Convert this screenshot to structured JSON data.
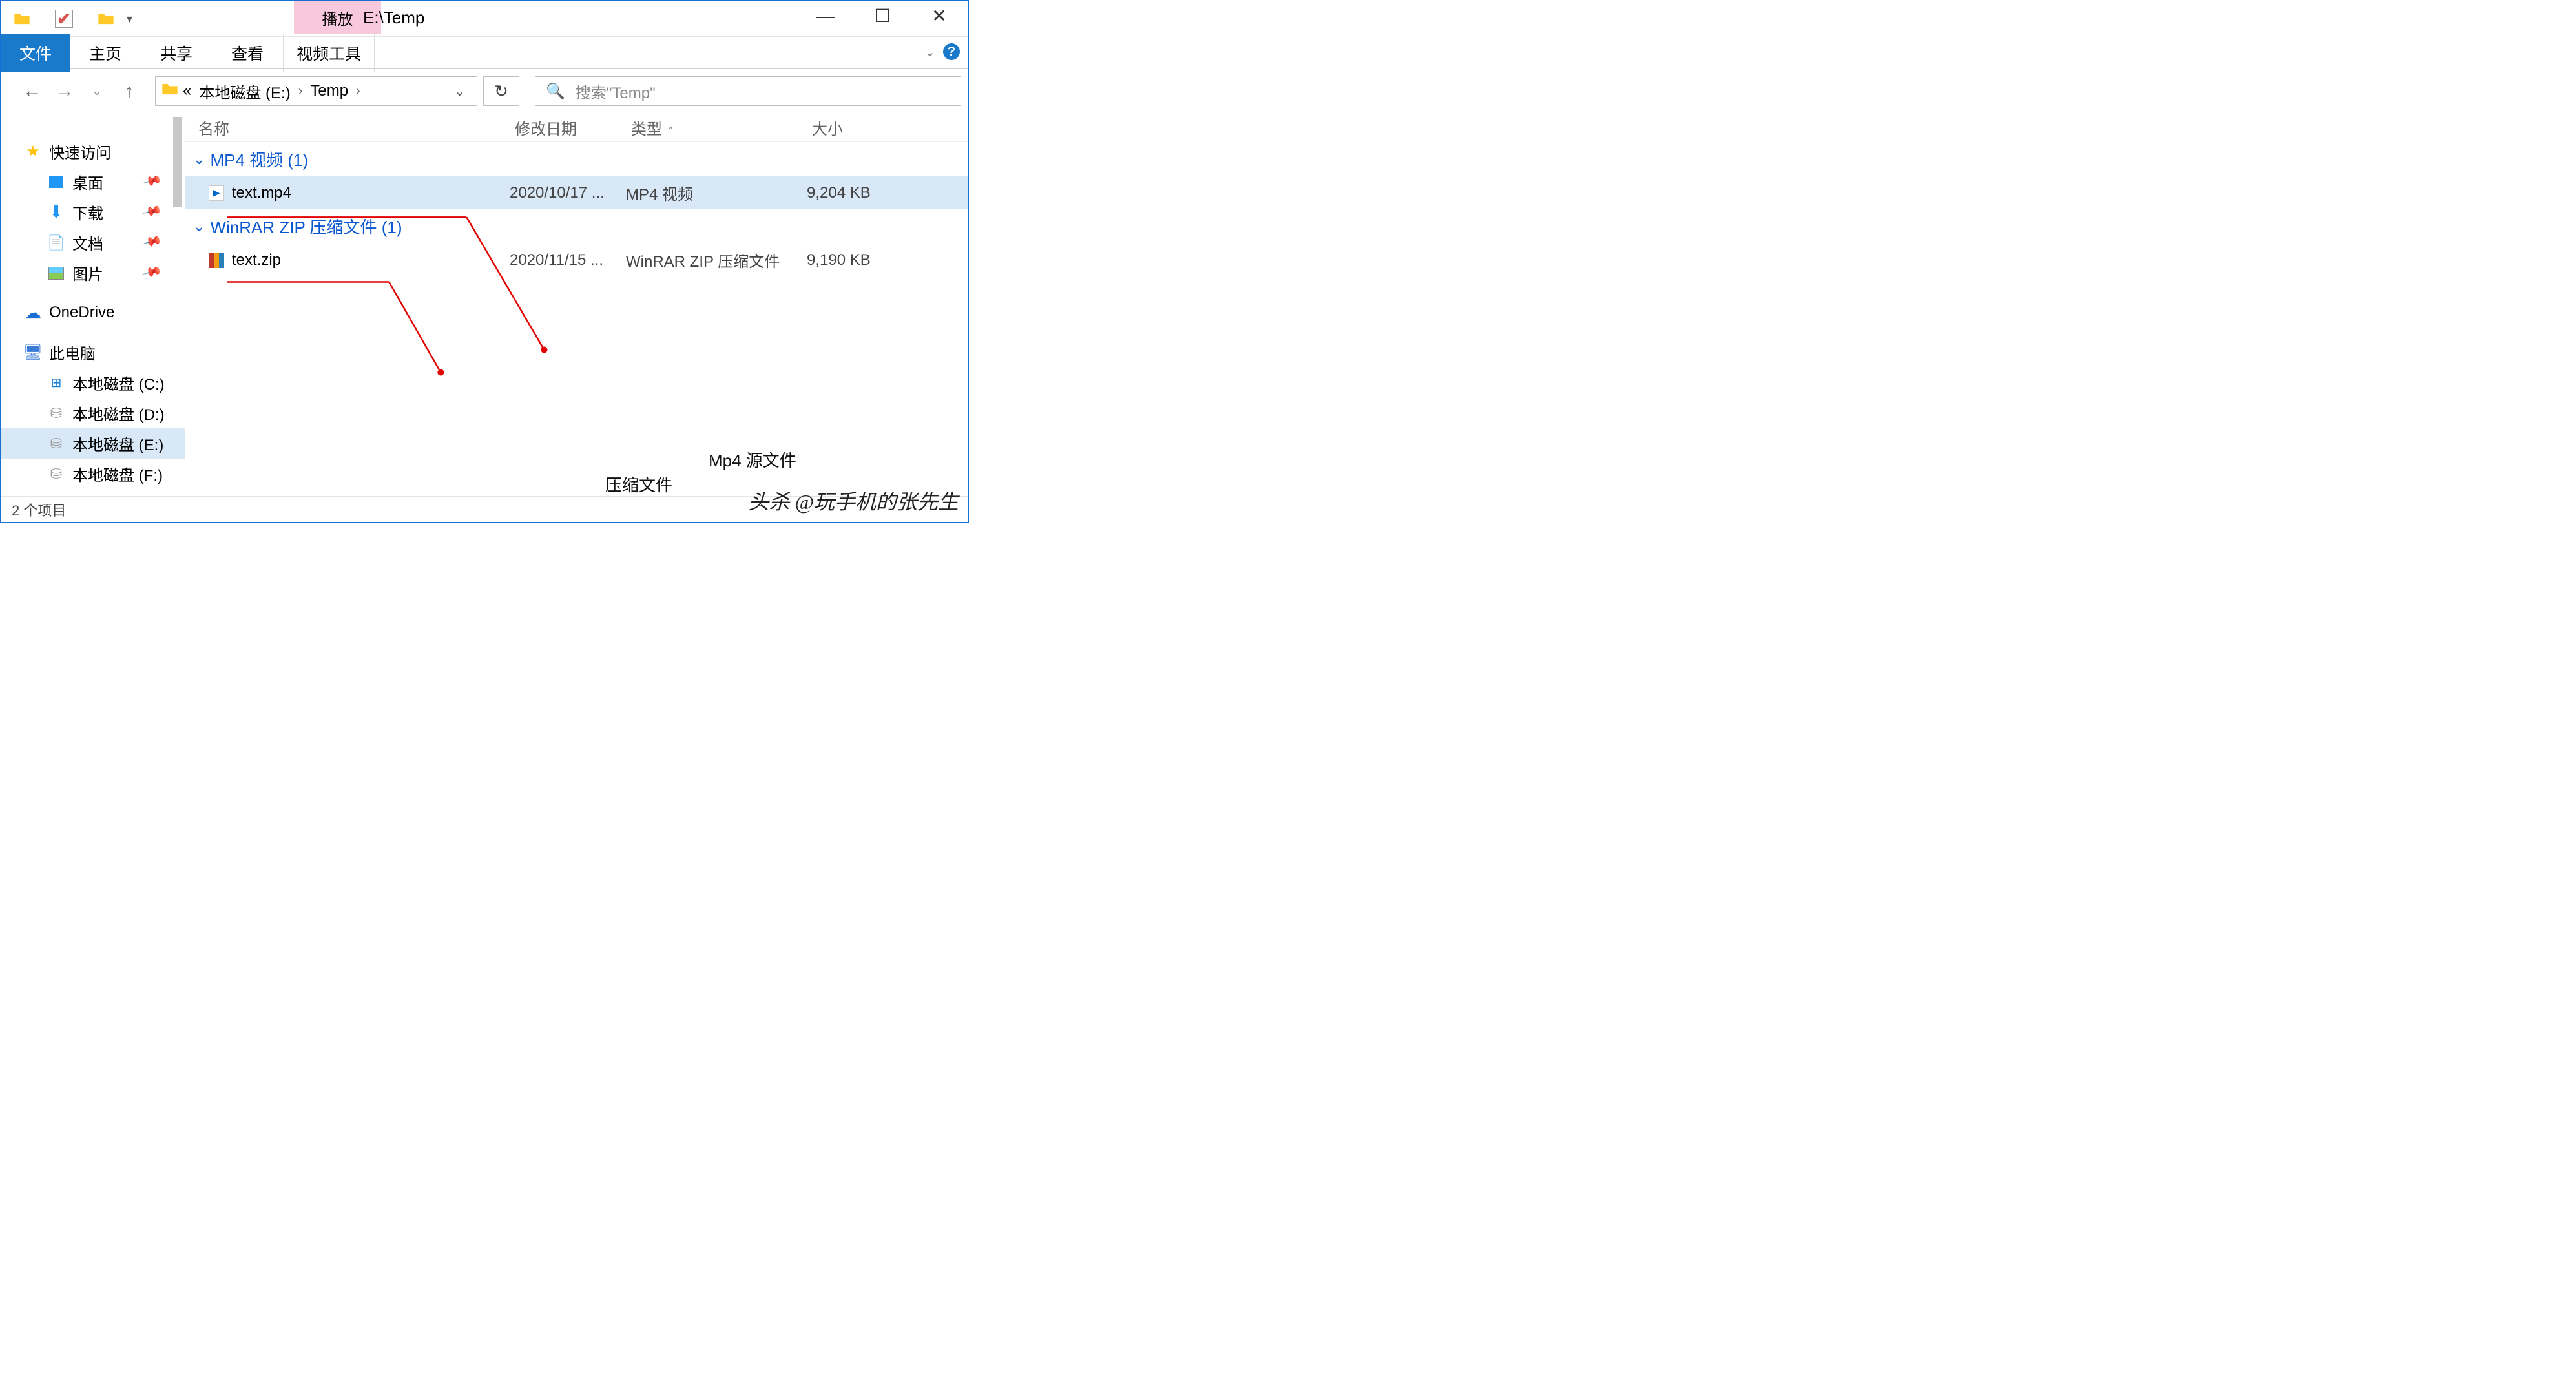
{
  "window": {
    "title": "E:\\Temp",
    "contextual_tab_play": "播放",
    "contextual_tab_tools": "视频工具"
  },
  "ribbon": {
    "file": "文件",
    "tabs": [
      "主页",
      "共享",
      "查看"
    ]
  },
  "breadcrumb": {
    "prefix": "«",
    "parts": [
      "本地磁盘 (E:)",
      "Temp"
    ]
  },
  "search": {
    "placeholder": "搜索\"Temp\""
  },
  "columns": {
    "name": "名称",
    "date": "修改日期",
    "type": "类型",
    "size": "大小"
  },
  "sidebar": {
    "quick": "快速访问",
    "desktop": "桌面",
    "downloads": "下载",
    "documents": "文档",
    "pictures": "图片",
    "onedrive": "OneDrive",
    "thispc": "此电脑",
    "disks": [
      "本地磁盘 (C:)",
      "本地磁盘 (D:)",
      "本地磁盘 (E:)",
      "本地磁盘 (F:)"
    ]
  },
  "groups": [
    {
      "label": "MP4 视频 (1)",
      "files": [
        {
          "name": "text.mp4",
          "date": "2020/10/17 ...",
          "type": "MP4 视频",
          "size": "9,204 KB",
          "icon": "mp4"
        }
      ]
    },
    {
      "label": "WinRAR ZIP 压缩文件 (1)",
      "files": [
        {
          "name": "text.zip",
          "date": "2020/11/15 ...",
          "type": "WinRAR ZIP 压缩文件",
          "size": "9,190 KB",
          "icon": "zip"
        }
      ]
    }
  ],
  "status": {
    "items": "2 个项目"
  },
  "annotations": {
    "compressed": "压缩文件",
    "source": "Mp4 源文件"
  },
  "watermark": "头杀 @玩手机的张先生"
}
